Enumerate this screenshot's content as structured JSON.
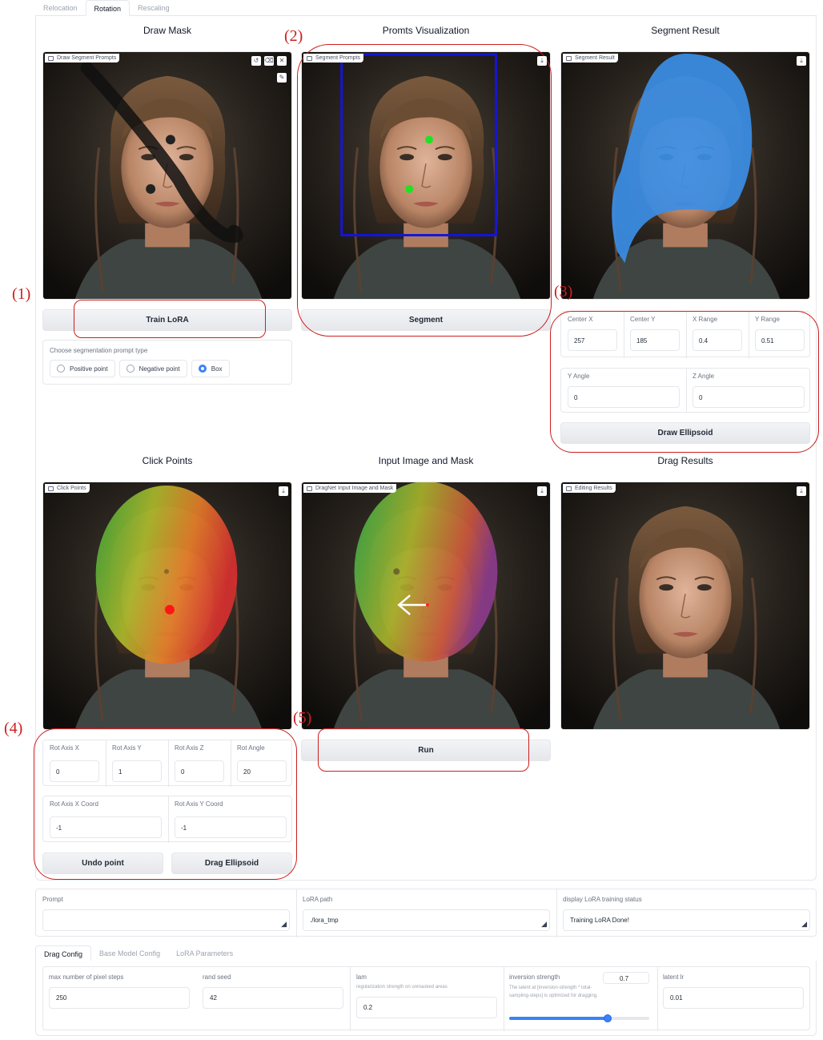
{
  "top_tabs": [
    "Relocation",
    "Rotation",
    "Rescaling"
  ],
  "titles": {
    "draw_mask": "Draw Mask",
    "promts_vis": "Promts Visualization",
    "segment_result": "Segment Result",
    "click_points": "Click Points",
    "input_image_mask": "Input Image and Mask",
    "drag_results": "Drag Results"
  },
  "panels": {
    "draw_segment_prompts": "Draw Segment Prompts",
    "segment_prompts": "Segment Prompts",
    "segment_result": "Segment Result",
    "click_points": "Click Points",
    "dragnet_input": "DragNet Input Image and Mask",
    "editing_results": "Editing Results"
  },
  "buttons": {
    "train_lora": "Train LoRA",
    "segment": "Segment",
    "draw_ellipsoid": "Draw Ellipsoid",
    "run": "Run",
    "undo_point": "Undo point",
    "drag_ellipsoid": "Drag Ellipsoid"
  },
  "prompt_type": {
    "label": "Choose segmentation prompt type",
    "options": [
      "Positive point",
      "Negative point",
      "Box"
    ],
    "selected": "Box"
  },
  "ellipsoid": {
    "center_x": {
      "label": "Center X",
      "value": "257"
    },
    "center_y": {
      "label": "Center Y",
      "value": "185"
    },
    "x_range": {
      "label": "X Range",
      "value": "0.4"
    },
    "y_range": {
      "label": "Y Range",
      "value": "0.51"
    },
    "y_angle": {
      "label": "Y Angle",
      "value": "0"
    },
    "z_angle": {
      "label": "Z Angle",
      "value": "0"
    }
  },
  "rotation": {
    "rot_axis_x": {
      "label": "Rot Axis X",
      "value": "0"
    },
    "rot_axis_y": {
      "label": "Rot Axis Y",
      "value": "1"
    },
    "rot_axis_z": {
      "label": "Rot Axis Z",
      "value": "0"
    },
    "rot_angle": {
      "label": "Rot Angle",
      "value": "20"
    },
    "rot_axis_x_coord": {
      "label": "Rot Axis X Coord",
      "value": "-1"
    },
    "rot_axis_y_coord": {
      "label": "Rot Axis Y Coord",
      "value": "-1"
    }
  },
  "annotations": [
    "(1)",
    "(2)",
    "(3)",
    "(4)",
    "(5)"
  ],
  "prompt_row": {
    "prompt_label": "Prompt",
    "prompt_value": "",
    "lora_path_label": "LoRA path",
    "lora_path_value": "./lora_tmp",
    "status_label": "display LoRA training status",
    "status_value": "Training LoRA Done!"
  },
  "config_tabs": [
    "Drag Config",
    "Base Model Config",
    "LoRA Parameters"
  ],
  "drag_config": {
    "max_steps_label": "max number of pixel steps",
    "max_steps_value": "250",
    "rand_seed_label": "rand seed",
    "rand_seed_value": "42",
    "lam_label": "lam",
    "lam_desc": "regularization strength on unmasked areas",
    "lam_value": "0.2",
    "inversion_label": "inversion strength",
    "inversion_value": "0.7",
    "inversion_fraction": 0.7,
    "inversion_desc": "The latent at [inversion-strength * total-sampling-steps] is optimized for dragging.",
    "latent_lr_label": "latent lr",
    "latent_lr_value": "0.01"
  },
  "colors": {
    "annotation": "#cc1f1f",
    "accent": "#3b82f6",
    "mask_blue": "#3b8ee6"
  }
}
